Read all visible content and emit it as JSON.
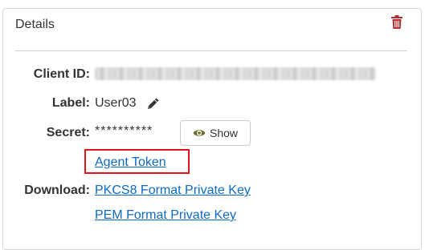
{
  "panel": {
    "title": "Details",
    "delete_icon": "trash-icon",
    "accent_color": "#b52d2d"
  },
  "fields": {
    "client_id_label": "Client ID:",
    "client_id_value": "",
    "label_label": "Label:",
    "label_value": "User03",
    "edit_icon": "pencil-icon",
    "secret_label": "Secret:",
    "secret_value": "**********",
    "show_button_label": "Show",
    "show_button_icon": "eye-icon",
    "download_label": "Download:"
  },
  "links": {
    "agent_token": "Agent Token",
    "pkcs8_key": "PKCS8 Format Private Key",
    "pem_key": "PEM Format Private Key",
    "link_color": "#0d6ac2",
    "highlight_color": "#e0151b"
  }
}
